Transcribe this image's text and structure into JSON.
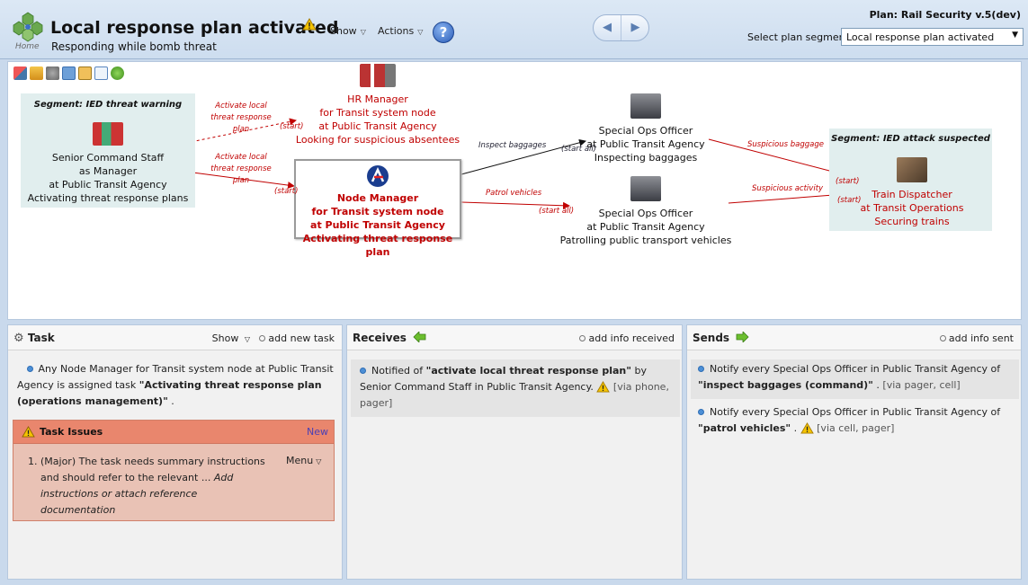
{
  "header": {
    "title": "Local response plan activated",
    "subtitle": "Responding while bomb threat",
    "home_label": "Home",
    "show_label": "Show",
    "actions_label": "Actions",
    "help_label": "?",
    "plan_name": "Plan: Rail Security v.5(dev)",
    "segment_label": "Select plan segment:",
    "segment_value": "Local response plan activated"
  },
  "flow": {
    "segment_left_title": "Segment: IED threat warning",
    "segment_right_title": "Segment: IED attack suspected",
    "nodes": {
      "senior": [
        "Senior Command Staff",
        "as Manager",
        "at Public Transit Agency",
        "Activating threat response plans"
      ],
      "hr": [
        "HR Manager",
        "for Transit system node",
        "at Public Transit Agency",
        "Looking for suspicious absentees"
      ],
      "node_manager": [
        "Node Manager",
        "for Transit system node",
        "at Public Transit Agency",
        "Activating threat response plan"
      ],
      "ops1": [
        "Special Ops Officer",
        "at Public Transit Agency",
        "Inspecting baggages"
      ],
      "ops2": [
        "Special Ops Officer",
        "at Public Transit Agency",
        "Patrolling public transport vehicles"
      ],
      "dispatcher": [
        "Train Dispatcher",
        "at Transit Operations",
        "Securing trains"
      ]
    },
    "edges": {
      "activate_top": "Activate local threat response plan",
      "activate_bottom": "Activate local threat response plan",
      "inspect": "Inspect baggages",
      "patrol": "Patrol vehicles",
      "suspicious_baggage": "Suspicious baggage",
      "suspicious_activity": "Suspicious activity",
      "start": "(start)",
      "start_all": "(start all)"
    }
  },
  "task": {
    "title": "Task",
    "show_label": "Show",
    "add_label": "add new task",
    "assignment_prefix": "Any Node Manager for Transit system node at Public Transit Agency is assigned task ",
    "assignment_task": "\"Activating threat response plan (operations management)\"",
    "assignment_suffix": " .",
    "issues_title": "Task Issues",
    "issues_new": "New",
    "issue_number": "1.",
    "issue_text": "(Major) The task needs summary instructions and should refer to the relevant ...",
    "issue_hint": "Add instructions or attach reference documentation",
    "issue_menu": "Menu"
  },
  "receives": {
    "title": "Receives",
    "add_label": "add info received",
    "items": [
      {
        "prefix": "Notified of ",
        "bold": "\"activate local threat response plan\"",
        "suffix": " by Senior Command Staff in Public Transit Agency.",
        "channels": "[via phone, pager]"
      }
    ]
  },
  "sends": {
    "title": "Sends",
    "add_label": "add info sent",
    "items": [
      {
        "prefix": "Notify every Special Ops Officer in Public Transit Agency of ",
        "bold": "\"inspect baggages (command)\"",
        "suffix": " .",
        "channels": "[via pager, cell]"
      },
      {
        "prefix": "Notify every Special Ops Officer in Public Transit Agency of ",
        "bold": "\"patrol vehicles\"",
        "suffix": " .",
        "channels": "[via cell, pager]"
      }
    ]
  },
  "colors": {
    "accent_red": "#c00000",
    "segment_bg": "#e1eeee",
    "issues_header": "#e9866d",
    "issues_bg": "#e9c2b5",
    "bullet_blue": "#4c8fd6",
    "arrow_green": "#6cbf2f"
  },
  "icons": {
    "home": "home-logo-icon",
    "warning": "warning-icon",
    "help": "help-icon",
    "receives": "arrow-left-icon",
    "sends": "arrow-right-icon",
    "task": "gear-icon"
  }
}
